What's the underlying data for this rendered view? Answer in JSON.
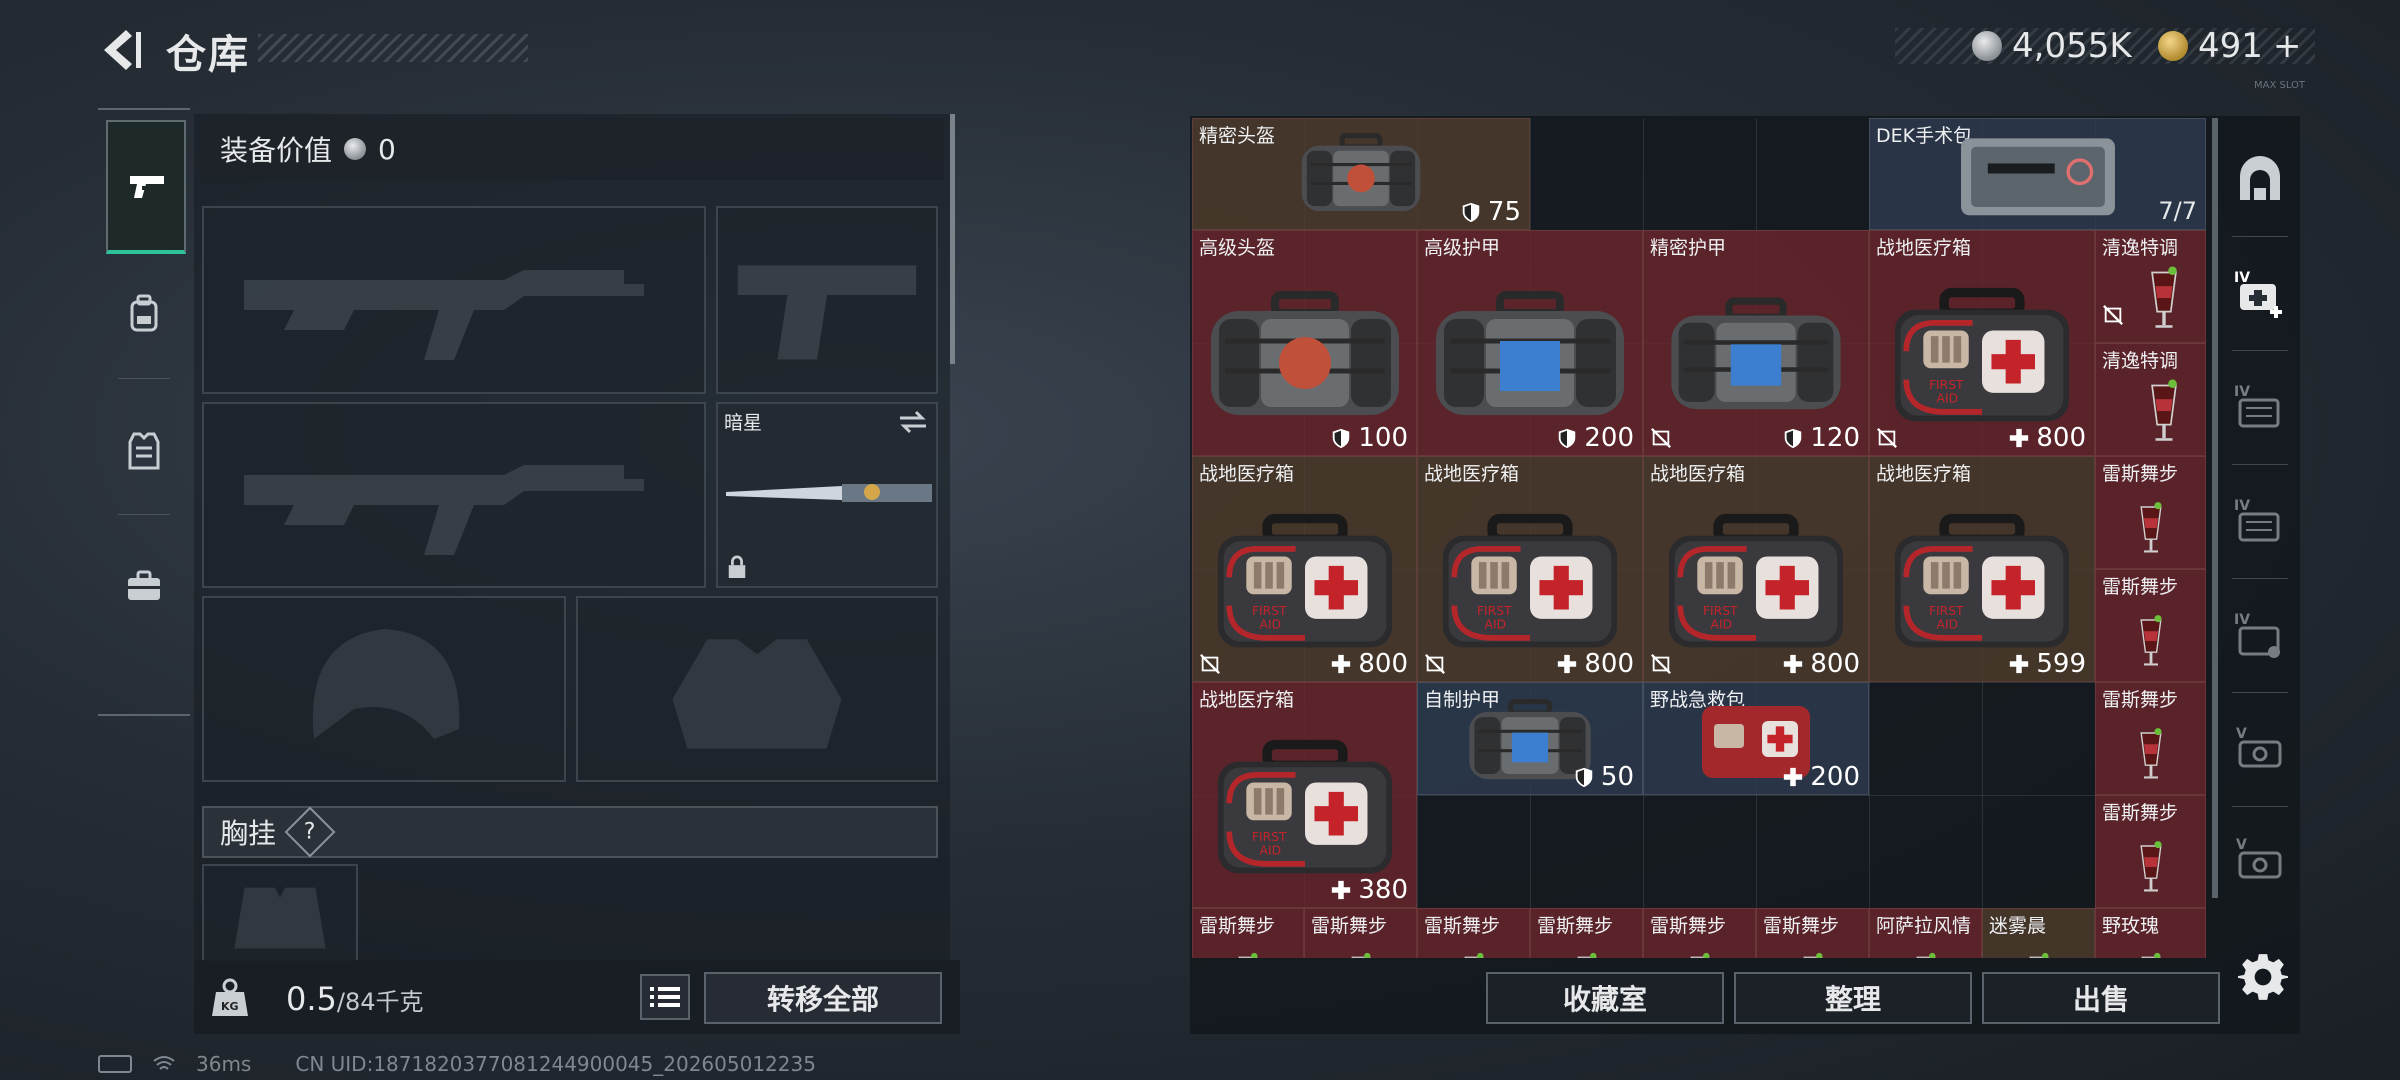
{
  "header": {
    "title": "仓库",
    "currency_silver": "4,055K",
    "currency_gold": "491",
    "gold_plus": "+",
    "tiny_note": "MAX SLOT"
  },
  "left_tabs": [
    "pistol-icon",
    "backpack-icon",
    "vest-icon",
    "toolbox-icon"
  ],
  "equipment": {
    "value_label": "装备价值",
    "value": "0",
    "melee_name": "暗星",
    "chest_label": "胸挂",
    "chest_hint": "?",
    "weight_current": "0.5",
    "weight_max": "/84千克",
    "transfer_all": "转移全部"
  },
  "status_bar": {
    "ping": "36ms",
    "uid": "CN UID:1871820377081244900045_202605012235"
  },
  "storage": {
    "items": [
      {
        "id": "precision-helmet-small",
        "name": "精密头盔",
        "value": "75",
        "kind": "armor"
      },
      {
        "id": "dek-kit",
        "name": "DEK手术包",
        "count": "7/7"
      },
      {
        "id": "advanced-helmet",
        "name": "高级头盔",
        "value": "100",
        "kind": "armor"
      },
      {
        "id": "advanced-armor",
        "name": "高级护甲",
        "value": "200",
        "kind": "armor"
      },
      {
        "id": "precision-armor",
        "name": "精密护甲",
        "value": "120",
        "kind": "armor"
      },
      {
        "id": "field-medkit-1",
        "name": "战地医疗箱",
        "value": "800",
        "kind": "heal"
      },
      {
        "id": "cocktail-1",
        "name": "清逸特调"
      },
      {
        "id": "cocktail-2",
        "name": "清逸特调"
      },
      {
        "id": "field-medkit-2",
        "name": "战地医疗箱",
        "value": "800",
        "kind": "heal"
      },
      {
        "id": "field-medkit-3",
        "name": "战地医疗箱",
        "value": "800",
        "kind": "heal"
      },
      {
        "id": "field-medkit-4",
        "name": "战地医疗箱",
        "value": "800",
        "kind": "heal"
      },
      {
        "id": "field-medkit-5",
        "name": "战地医疗箱",
        "value": "599",
        "kind": "heal"
      },
      {
        "id": "rex-dance-1",
        "name": "雷斯舞步"
      },
      {
        "id": "rex-dance-2",
        "name": "雷斯舞步"
      },
      {
        "id": "field-medkit-6",
        "name": "战地医疗箱",
        "value": "380",
        "kind": "heal"
      },
      {
        "id": "homemade-armor",
        "name": "自制护甲",
        "value": "50",
        "kind": "armor"
      },
      {
        "id": "field-first-aid",
        "name": "野战急救包",
        "value": "200",
        "kind": "heal"
      },
      {
        "id": "rex-dance-3",
        "name": "雷斯舞步"
      },
      {
        "id": "rex-dance-4",
        "name": "雷斯舞步"
      },
      {
        "id": "rex-dance-5",
        "name": "雷斯舞步"
      },
      {
        "id": "rex-dance-6",
        "name": "雷斯舞步"
      },
      {
        "id": "rex-dance-7",
        "name": "雷斯舞步"
      },
      {
        "id": "rex-dance-8",
        "name": "雷斯舞步"
      },
      {
        "id": "rex-dance-9",
        "name": "雷斯舞步"
      },
      {
        "id": "rex-dance-10",
        "name": "雷斯舞步"
      },
      {
        "id": "asala-romance",
        "name": "阿萨拉风情"
      },
      {
        "id": "mist-morning",
        "name": "迷雾晨"
      },
      {
        "id": "wild-rose",
        "name": "野玫瑰"
      }
    ],
    "buttons": {
      "collection": "收藏室",
      "organize": "整理",
      "sell": "出售"
    }
  },
  "right_tabs": [
    "safe-box-icon",
    "medical-case-iv-icon",
    "folder-iv-1-icon",
    "folder-iv-2-icon",
    "folder-iv-3-icon",
    "case-v-1-icon",
    "case-v-2-icon"
  ],
  "colors": {
    "accent_green": "#2dc29a",
    "cell_red": "#6e262d",
    "cell_brown": "#523e2d",
    "cell_blue": "#303e52"
  }
}
